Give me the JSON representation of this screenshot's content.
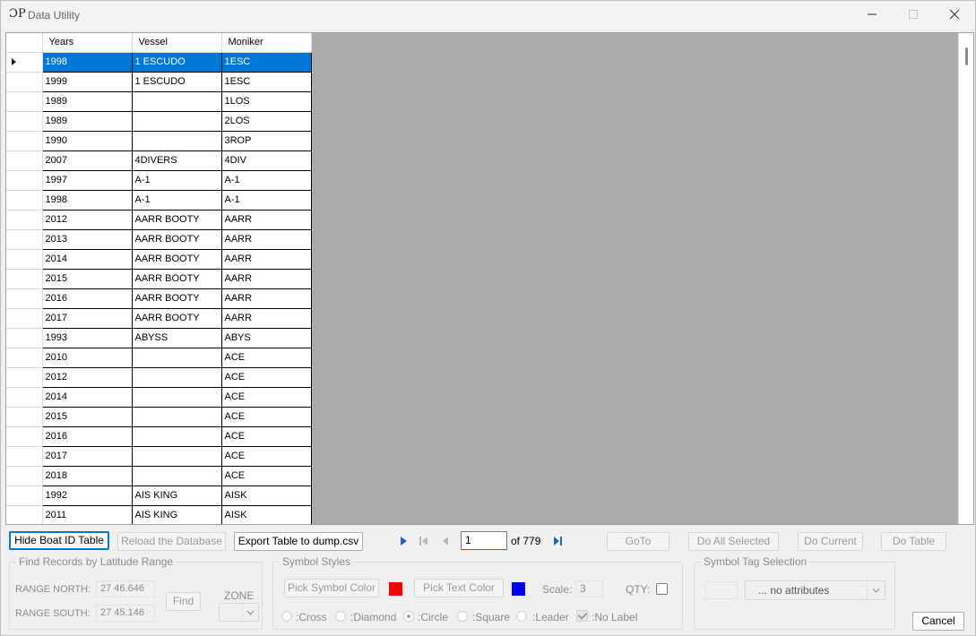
{
  "window": {
    "title": "Data Utility",
    "app_icon_glyph": "ƆP",
    "controls": [
      "minimize",
      "maximize",
      "close"
    ]
  },
  "table": {
    "columns": [
      "Years",
      "Vessel",
      "Moniker"
    ],
    "selected_row_index": 0,
    "rows": [
      [
        "1998",
        "1 ESCUDO",
        "1ESC"
      ],
      [
        "1999",
        "1 ESCUDO",
        "1ESC"
      ],
      [
        "1989",
        "",
        "1LOS"
      ],
      [
        "1989",
        "",
        "2LOS"
      ],
      [
        "1990",
        "",
        "3ROP"
      ],
      [
        "2007",
        "4DIVERS",
        "4DIV"
      ],
      [
        "1997",
        "A-1",
        "A-1"
      ],
      [
        "1998",
        "A-1",
        "A-1"
      ],
      [
        "2012",
        "AARR BOOTY",
        "AARR"
      ],
      [
        "2013",
        "AARR BOOTY",
        "AARR"
      ],
      [
        "2014",
        "AARR BOOTY",
        "AARR"
      ],
      [
        "2015",
        "AARR BOOTY",
        "AARR"
      ],
      [
        "2016",
        "AARR BOOTY",
        "AARR"
      ],
      [
        "2017",
        "AARR BOOTY",
        "AARR"
      ],
      [
        "1993",
        "ABYSS",
        "ABYS"
      ],
      [
        "2010",
        "",
        "ACE"
      ],
      [
        "2012",
        "",
        "ACE"
      ],
      [
        "2014",
        "",
        "ACE"
      ],
      [
        "2015",
        "",
        "ACE"
      ],
      [
        "2016",
        "",
        "ACE"
      ],
      [
        "2017",
        "",
        "ACE"
      ],
      [
        "2018",
        "",
        "ACE"
      ],
      [
        "1992",
        "AIS KING",
        "AISK"
      ],
      [
        "2011",
        "AIS KING",
        "AISK"
      ]
    ]
  },
  "toolbar": {
    "hide_boat_id": "Hide Boat ID Table",
    "reload_db": "Reload the Database",
    "export_csv": "Export Table to dump.csv",
    "page_value": "1",
    "page_of": "of 779",
    "goto": "GoTo",
    "do_all_selected": "Do All Selected",
    "do_current": "Do Current",
    "do_table": "Do Table"
  },
  "find_records": {
    "title": "Find Records by Latitude Range",
    "range_north_label": "RANGE NORTH:",
    "range_north_value": "27 46.646",
    "range_south_label": "RANGE SOUTH:",
    "range_south_value": "27 45.146",
    "find_button": "Find",
    "zone_label": "ZONE"
  },
  "symbol_styles": {
    "title": "Symbol Styles",
    "pick_symbol_color": "Pick Symbol Color",
    "symbol_color": "#ff0000",
    "pick_text_color": "Pick Text Color",
    "text_color": "#0000ff",
    "scale_label": "Scale:",
    "scale_value": "3",
    "qty_label": "QTY:",
    "shapes": [
      ":Cross",
      ":Diamond",
      ":Circle",
      ":Square",
      ":Leader"
    ],
    "selected_shape": ":Circle",
    "no_label": ":No Label"
  },
  "symbol_tag": {
    "title": "Symbol Tag Selection",
    "dropdown_value": "... no attributes"
  },
  "cancel": "Cancel"
}
